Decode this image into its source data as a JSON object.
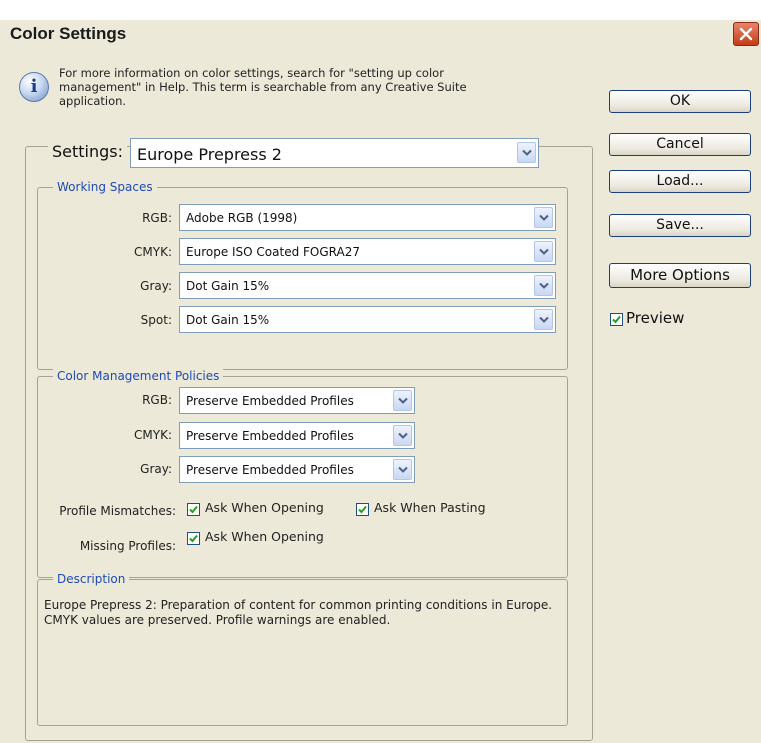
{
  "window": {
    "title": "Color Settings"
  },
  "info": {
    "text": "For more information on color settings, search for \"setting up color management\" in Help. This term is searchable from any Creative Suite application."
  },
  "buttons": {
    "ok": "OK",
    "cancel": "Cancel",
    "load": "Load...",
    "save": "Save...",
    "more_options": "More Options"
  },
  "preview": {
    "label": "Preview",
    "checked": true
  },
  "settings": {
    "label": "Settings:",
    "value": "Europe Prepress 2"
  },
  "working_spaces": {
    "legend": "Working Spaces",
    "rgb": {
      "label": "RGB:",
      "value": "Adobe RGB (1998)"
    },
    "cmyk": {
      "label": "CMYK:",
      "value": "Europe ISO Coated FOGRA27"
    },
    "gray": {
      "label": "Gray:",
      "value": "Dot Gain 15%"
    },
    "spot": {
      "label": "Spot:",
      "value": "Dot Gain 15%"
    }
  },
  "policies": {
    "legend": "Color Management Policies",
    "rgb": {
      "label": "RGB:",
      "value": "Preserve Embedded Profiles"
    },
    "cmyk": {
      "label": "CMYK:",
      "value": "Preserve Embedded Profiles"
    },
    "gray": {
      "label": "Gray:",
      "value": "Preserve Embedded Profiles"
    },
    "profile_mismatches": {
      "label": "Profile Mismatches:",
      "ask_opening": "Ask When Opening",
      "ask_pasting": "Ask When Pasting"
    },
    "missing_profiles": {
      "label": "Missing Profiles:",
      "ask_opening": "Ask When Opening"
    }
  },
  "description": {
    "legend": "Description",
    "text": "Europe Prepress 2:  Preparation of content for common printing conditions in Europe. CMYK values are preserved. Profile warnings are enabled."
  }
}
